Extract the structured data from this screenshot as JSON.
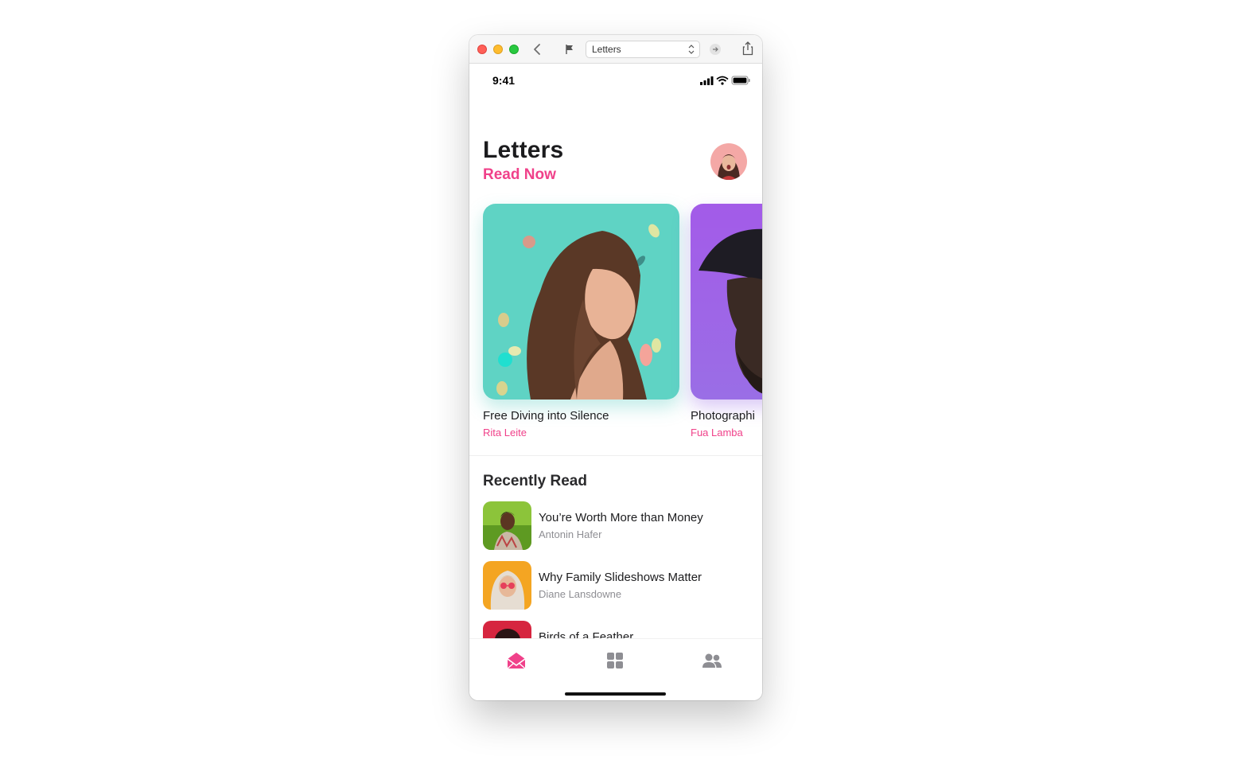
{
  "toolbar": {
    "select_value": "Letters"
  },
  "status": {
    "time": "9:41"
  },
  "header": {
    "title": "Letters",
    "subtitle": "Read Now"
  },
  "featured": [
    {
      "title": "Free Diving into Silence",
      "author": "Rita Leite"
    },
    {
      "title": "Photographi",
      "author": "Fua Lamba"
    }
  ],
  "recent": {
    "title": "Recently Read",
    "items": [
      {
        "title": "You’re Worth More than Money",
        "author": "Antonin Hafer"
      },
      {
        "title": "Why Family Slideshows Matter",
        "author": "Diane Lansdowne"
      },
      {
        "title": "Birds of a Feather",
        "author": ""
      }
    ]
  },
  "colors": {
    "accent": "#f0418a",
    "card1_bg": "#5fd3c4",
    "card2_bg": "#a35be8"
  },
  "icons": {
    "tab_letters": "envelope-open-icon",
    "tab_grid": "grid-icon",
    "tab_people": "people-icon"
  }
}
